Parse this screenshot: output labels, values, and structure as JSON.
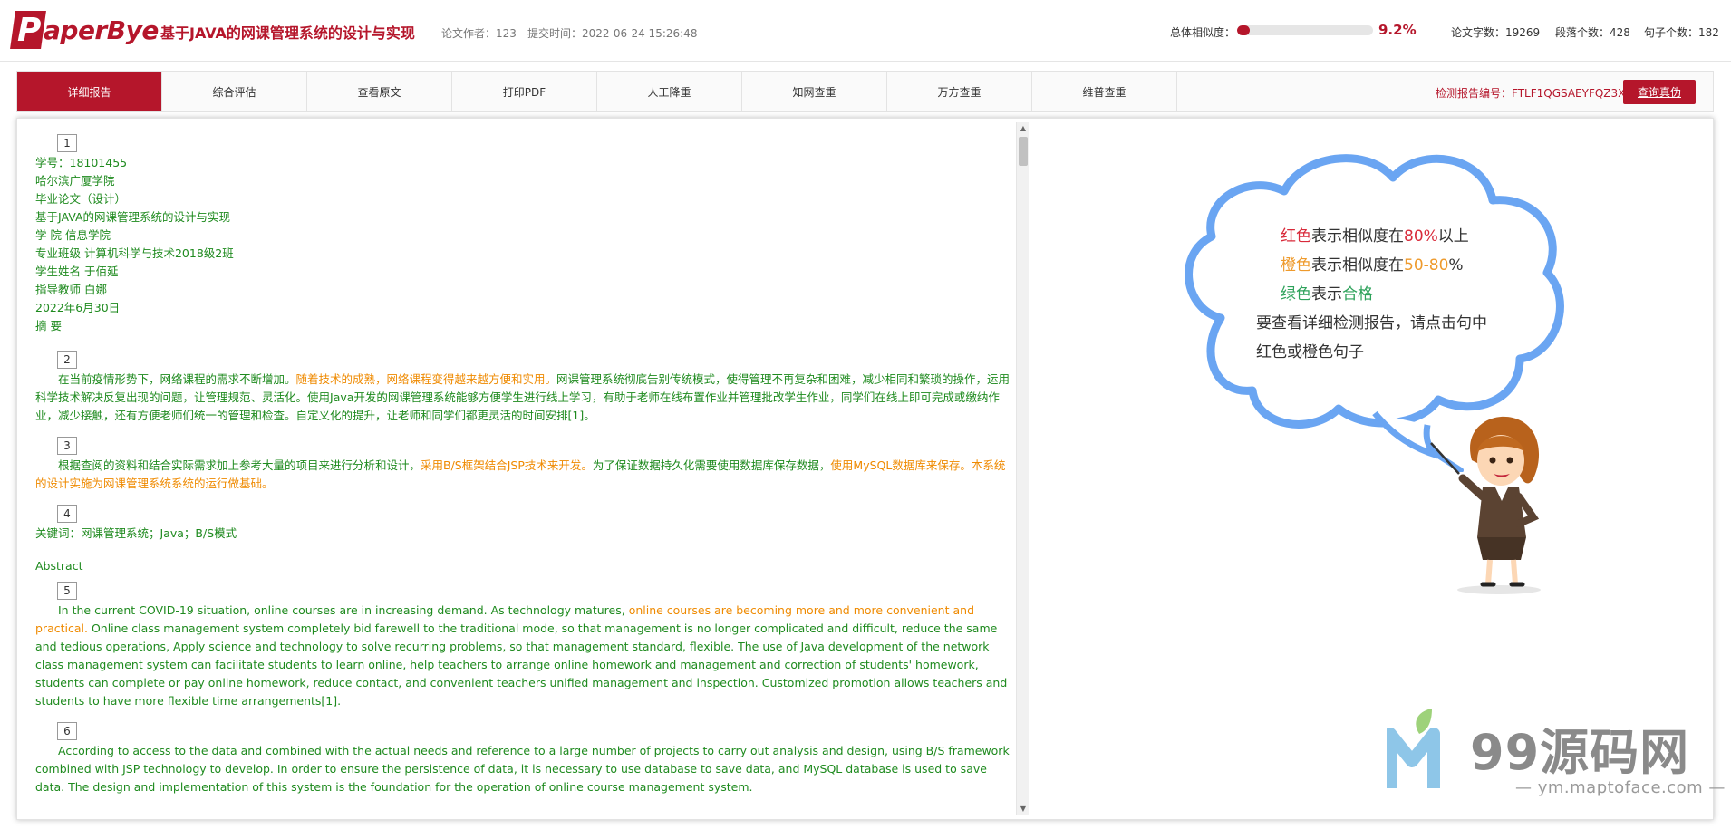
{
  "header": {
    "logo_letter": "P",
    "logo_text": "aperBye",
    "paper_title": "基于JAVA的网课管理系统的设计与实现",
    "author_label": "论文作者：123",
    "submit_label": "提交时间：2022-06-24 15:26:48",
    "similarity_label": "总体相似度：",
    "similarity_value": "9.2%",
    "similarity_fraction": 0.092,
    "word_count": "论文字数：19269",
    "para_count": "段落个数：428",
    "sentence_count": "句子个数：182"
  },
  "tabs": [
    {
      "label": "详细报告",
      "active": true
    },
    {
      "label": "综合评估",
      "active": false
    },
    {
      "label": "查看原文",
      "active": false
    },
    {
      "label": "打印PDF",
      "active": false
    },
    {
      "label": "人工降重",
      "active": false
    },
    {
      "label": "知网查重",
      "active": false
    },
    {
      "label": "万方查重",
      "active": false
    },
    {
      "label": "维普查重",
      "active": false
    }
  ],
  "toolbar": {
    "report_no": "检测报告编号：FTLF1QGSAEYFQZ3X",
    "verify_label": "查询真伪"
  },
  "document": {
    "p1_num": "1",
    "p1_lines": [
      "学号：18101455",
      "哈尔滨广厦学院",
      "毕业论文（设计）",
      "基于JAVA的网课管理系统的设计与实现",
      "学 院 信息学院",
      "专业班级 计算机科学与技术2018级2班",
      "学生姓名 于佰延",
      "指导教师 白娜",
      "2022年6月30日",
      "摘 要"
    ],
    "p2_num": "2",
    "p2_a": "在当前疫情形势下，网络课程的需求不断增加。",
    "p2_b": "随着技术的成熟，网络课程变得越来越方便和实用。",
    "p2_c": "网课管理系统彻底告别传统模式，使得管理不再复杂和困难，减少相同和繁琐的操作，运用科学技术解决反复出现的问题，让管理规范、灵活化。使用Java开发的网课管理系统能够方便学生进行线上学习，有助于老师在线布置作业并管理批改学生作业，同学们在线上即可完成或缴纳作业，减少接触，还有方便老师们统一的管理和检查。自定义化的提升，让老师和同学们都更灵活的时间安排[1]。",
    "p3_num": "3",
    "p3_a": "根据查阅的资料和结合实际需求加上参考大量的项目来进行分析和设计，",
    "p3_b": "采用B/S框架结合JSP技术来开发。",
    "p3_c": "为了保证数据持久化需要使用数据库保存数据，",
    "p3_d": "使用MySQL数据库来保存。本系统的设计实施为网课管理系统系统的运行做基础。",
    "p4_num": "4",
    "p4_line": "关键词：网课管理系统；Java；B/S模式",
    "abstract_title": "Abstract",
    "p5_num": "5",
    "p5_a": "In the current COVID-19 situation, online courses are in increasing demand. As technology matures, ",
    "p5_b": "online courses are becoming more and more convenient and practical.",
    "p5_c": " Online class management system completely bid farewell to the traditional mode, so that management is no longer complicated and difficult, reduce the same and tedious operations, Apply science and technology to solve recurring problems, so that management standard, flexible. The use of Java development of the network class management system can facilitate students to learn online, help teachers to arrange online homework and management and correction of students' homework, students can complete or pay online homework, reduce contact, and convenient teachers unified management and inspection. Customized promotion allows teachers and students to have more flexible time arrangements[1].",
    "p6_num": "6",
    "p6_a": "According to access to the data and combined with the actual needs and reference to a large number of projects to carry out analysis and design, using B/S framework combined with JSP technology to develop. In order to ensure the persistence of data, it is necessary to use database to save data, and MySQL database is used to save data. The design and implementation of this system is the foundation for the operation of online course management system."
  },
  "legend": {
    "red_word": "红色",
    "red_mid": "表示相似度在",
    "red_val": "80%",
    "red_end": "以上",
    "orange_word": "橙色",
    "orange_mid": "表示相似度在",
    "orange_val": "50-80",
    "orange_end": "%",
    "green_word": "绿色",
    "green_mid": "表示",
    "green_val": "合格",
    "hint1": "要查看详细检测报告，请点击句中",
    "hint2": "红色或橙色句子"
  },
  "watermark": {
    "text": "99源码网",
    "url": "— ym.maptoface.com —"
  },
  "colors": {
    "brand": "#b5162b",
    "green_text": "#1e8a1e",
    "orange_text": "#ef8a00",
    "cloud": "#6aa5f2"
  },
  "icons": [
    "scroll-up-arrow-icon",
    "scroll-down-arrow-icon",
    "teacher-illustration",
    "cloud-bubble",
    "watermark-logo-icon"
  ]
}
